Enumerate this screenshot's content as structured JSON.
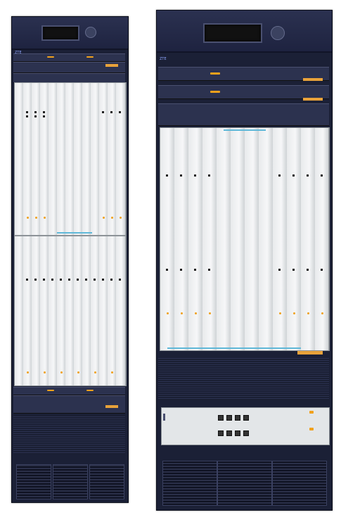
{
  "racks": [
    {
      "name": "left-rack",
      "brand": "ZTE"
    },
    {
      "name": "right-rack",
      "brand": "ZTE"
    }
  ],
  "colors": {
    "frame": "#1b2036",
    "accent": "#f0a11c",
    "shelf": "#d9dde0",
    "indicator": "#5fb8d8"
  }
}
